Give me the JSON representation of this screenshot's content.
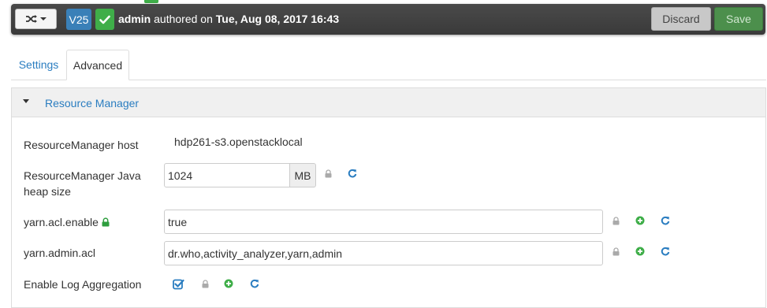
{
  "version_bar": {
    "version_badge": "V25",
    "author": "admin",
    "authored_text": " authored on ",
    "timestamp": "Tue, Aug 08, 2017 16:43",
    "discard_label": "Discard",
    "save_label": "Save"
  },
  "tabs": [
    {
      "label": "Settings",
      "active": false
    },
    {
      "label": "Advanced",
      "active": true
    }
  ],
  "section": {
    "title": "Resource Manager",
    "expanded": true
  },
  "fields": {
    "rm_host": {
      "label": "ResourceManager host",
      "value": "hdp261-s3.openstacklocal"
    },
    "rm_heap": {
      "label_line1": "ResourceManager Java",
      "label_line2": "heap size",
      "value": "1024",
      "unit": "MB"
    },
    "acl_enable": {
      "label": "yarn.acl.enable",
      "value": "true"
    },
    "admin_acl": {
      "label": "yarn.admin.acl",
      "value": "dr.who,activity_analyzer,yarn,admin"
    },
    "log_aggregation": {
      "label": "Enable Log Aggregation",
      "checked": true
    }
  },
  "colors": {
    "link_blue": "#2a7dc0",
    "badge_blue": "#3a80b8",
    "success_green": "#3fae49",
    "save_green": "#4c8f4c",
    "lock_gray": "#aaaaaa"
  },
  "icons": [
    "shuffle-icon",
    "caret-down-icon",
    "check-icon",
    "lock-icon",
    "plus-circle-icon",
    "refresh-icon",
    "checkbox-icon"
  ]
}
